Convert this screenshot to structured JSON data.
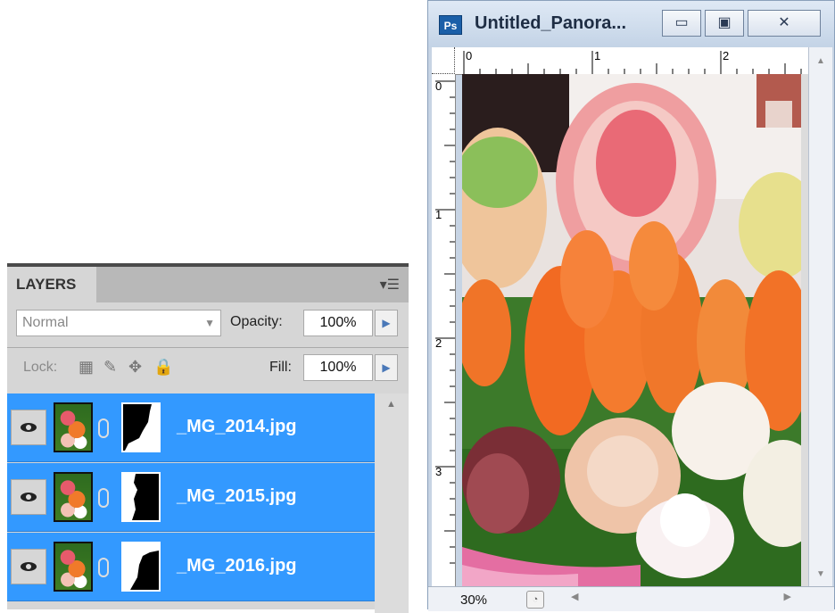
{
  "layers_panel": {
    "tab_label": "LAYERS",
    "blend_mode": "Normal",
    "opacity_label": "Opacity:",
    "opacity_value": "100%",
    "lock_label": "Lock:",
    "fill_label": "Fill:",
    "fill_value": "100%",
    "layers": [
      {
        "name": "_MG_2014.jpg"
      },
      {
        "name": "_MG_2015.jpg"
      },
      {
        "name": "_MG_2016.jpg"
      }
    ]
  },
  "document_window": {
    "app_icon_text": "Ps",
    "title": "Untitled_Panora...",
    "ruler_top_labels": [
      "0",
      "1",
      "2"
    ],
    "ruler_left_labels": [
      "0",
      "1",
      "2",
      "3"
    ],
    "zoom": "30%"
  },
  "colors": {
    "selection": "#3399ff",
    "panel_bg": "#d6d6d6",
    "window_chrome": "#c7d4e4"
  }
}
